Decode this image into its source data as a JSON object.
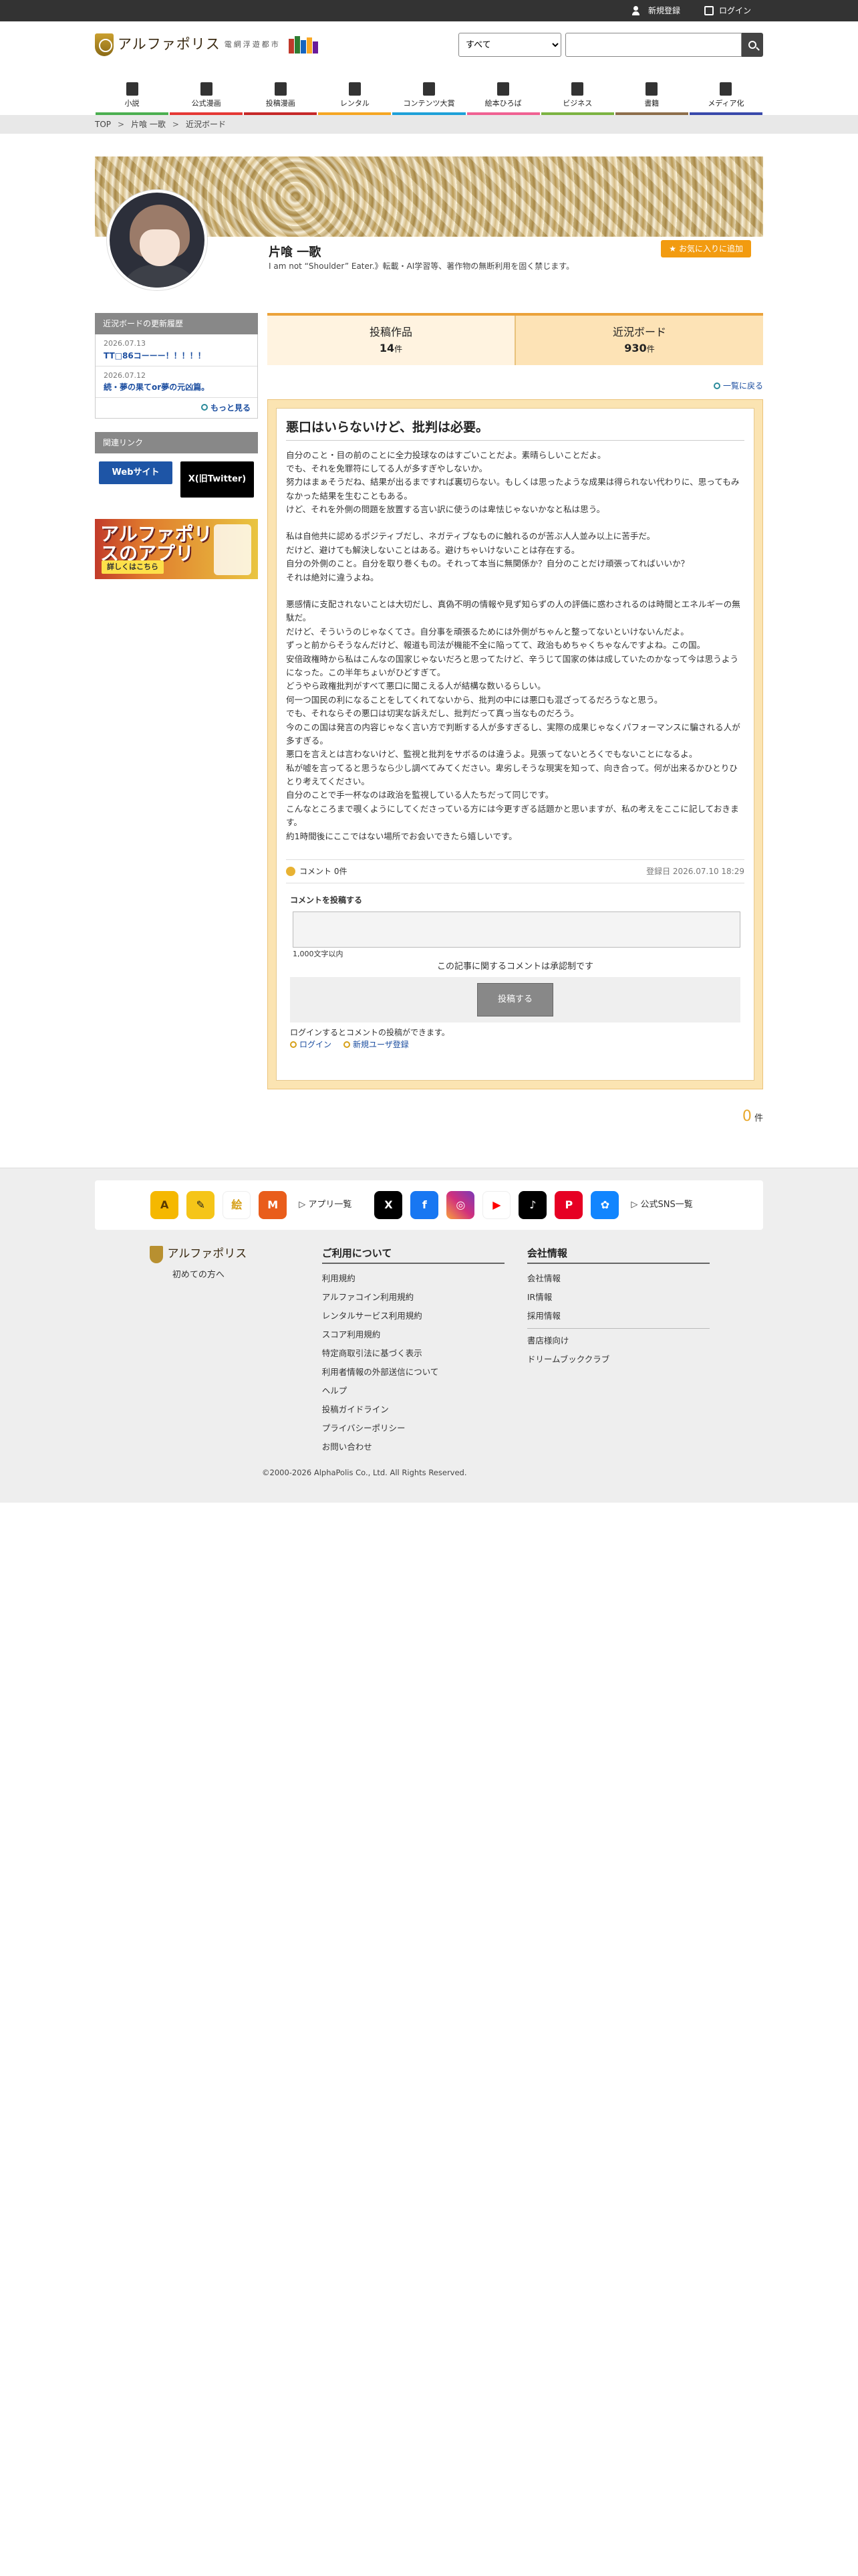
{
  "topbar": {
    "register": "新規登録",
    "login": "ログイン"
  },
  "header": {
    "logo_text": "アルファポリス",
    "logo_sub": "電網浮遊都市",
    "search_select": "すべて",
    "search_placeholder": ""
  },
  "nav": [
    {
      "label": "小説",
      "color": "#4caf50"
    },
    {
      "label": "公式漫画",
      "color": "#e53935"
    },
    {
      "label": "投稿漫画",
      "color": "#c62828"
    },
    {
      "label": "レンタル",
      "color": "#f5a623"
    },
    {
      "label": "コンテンツ大賞",
      "color": "#1ea0d8"
    },
    {
      "label": "絵本ひろば",
      "color": "#f06292"
    },
    {
      "label": "ビジネス",
      "color": "#7cb342"
    },
    {
      "label": "書籍",
      "color": "#8d6e4b"
    },
    {
      "label": "メディア化",
      "color": "#3949ab"
    }
  ],
  "breadcrumb": [
    "TOP",
    "片喰 一歌",
    "近況ボード"
  ],
  "profile": {
    "name": "片喰 一歌",
    "desc": "I am not “Shoulder” Eater.》転載・AI学習等、著作物の無断利用を固く禁じます。",
    "fav": "お気に入りに追加"
  },
  "sidebar": {
    "recent_header": "近況ボードの更新履歴",
    "entries": [
      {
        "date": "2026.07.13",
        "title": "TT□86コーーー！！！！！"
      },
      {
        "date": "2026.07.12",
        "title": "続・夢の果てor夢の元凶篇。"
      }
    ],
    "more": "もっと見る",
    "links_header": "関連リンク",
    "web": "Webサイト",
    "x": "X(旧Twitter)",
    "app_title": "アルファポリスのアプリ",
    "app_btn": "詳しくはこちら"
  },
  "tabs": {
    "posts_label": "投稿作品",
    "posts_count": "14",
    "board_label": "近況ボード",
    "board_count": "930",
    "unit": "件"
  },
  "back": "一覧に戻る",
  "post": {
    "title": "悪口はいらないけど、批判は必要。",
    "paragraphs": [
      [
        "自分のこと・目の前のことに全力投球なのはすごいことだよ。素晴らしいことだよ。",
        "でも、それを免罪符にしてる人が多すぎやしないか。",
        "努力はまぁそうだね、結果が出るまですれば裏切らない。もしくは思ったような成果は得られない代わりに、思ってもみなかった結果を生むこともある。",
        "けど、それを外側の問題を放置する言い訳に使うのは卑怯じゃないかなと私は思う。"
      ],
      [
        "私は自他共に認めるポジティブだし、ネガティブなものに触れるのが苦ぶ人人並み以上に苦手だ。",
        "だけど、避けても解決しないことはある。避けちゃいけないことは存在する。",
        "自分の外側のこと。自分を取り巻くもの。それって本当に無関係か？自分のことだけ頑張ってればいいか？",
        "それは絶対に違うよね。"
      ],
      [
        "悪感情に支配されないことは大切だし、真偽不明の情報や見ず知らずの人の評価に惑わされるのは時間とエネルギーの無駄だ。",
        "だけど、そういうのじゃなくてさ。自分事を頑張るためには外側がちゃんと整ってないといけないんだよ。",
        "ずっと前からそうなんだけど、報道も司法が機能不全に陥ってて、政治もめちゃくちゃなんですよね。この国。",
        "安倍政権時から私はこんなの国家じゃないだろと思ってたけど、辛うじて国家の体は成していたのかなって今は思うようになった。この半年ちょいがひどすぎて。",
        "どうやら政権批判がすべて悪口に聞こえる人が結構な数いるらしい。",
        "何一つ国民の利になることをしてくれてないから、批判の中には悪口も混ざってるだろうなと思う。",
        "でも、それならその悪口は切実な訴えだし、批判だって真っ当なものだろう。",
        "今のこの国は発言の内容じゃなく言い方で判断する人が多すぎるし、実際の成果じゃなくパフォーマンスに騙される人が多すぎる。",
        "悪口を言えとは言わないけど、監視と批判をサボるのは違うよ。見張ってないとろくでもないことになるよ。",
        "私が嘘を言ってると思うなら少し調べてみてください。卑劣しそうな現実を知って、向き合って。何が出来るかひとりひとり考えてください。",
        "自分のことで手一杯なのは政治を監視している人たちだって同じです。",
        "こんなところまで覗くようにしてくださっている方には今更すぎる話題かと思いますが、私の考えをここに記しておきます。",
        "約1時間後にここではない場所でお会いできたら嬉しいです。"
      ]
    ],
    "comments": "コメント 0件",
    "date": "登録日 2026.07.10 18:29"
  },
  "comment_form": {
    "label": "コメントを投稿する",
    "limit": "1,000文字以内",
    "approval": "この記事に関するコメントは承認制です",
    "post": "投稿する",
    "login_note": "ログインするとコメントの投稿ができます。",
    "login": "ログイン",
    "register": "新規ユーザ登録"
  },
  "pager": {
    "count": "0",
    "unit": "件"
  },
  "footer": {
    "app_list": "アプリ一覧",
    "sns_list": "公式SNS一覧",
    "logo": "アルファポリス",
    "first": "初めての方へ",
    "terms_h": "ご利用について",
    "terms": [
      "利用規約",
      "アルファコイン利用規約",
      "レンタルサービス利用規約",
      "スコア利用規約",
      "特定商取引法に基づく表示",
      "利用者情報の外部送信について",
      "ヘルプ",
      "投稿ガイドライン",
      "プライバシーポリシー",
      "お問い合わせ"
    ],
    "company_h": "会社情報",
    "company": [
      "会社情報",
      "IR情報",
      "採用情報"
    ],
    "company2": [
      "書店様向け",
      "ドリームブッククラブ"
    ],
    "copyright": "©2000-2026 AlphaPolis Co., Ltd. All Rights Reserved."
  }
}
